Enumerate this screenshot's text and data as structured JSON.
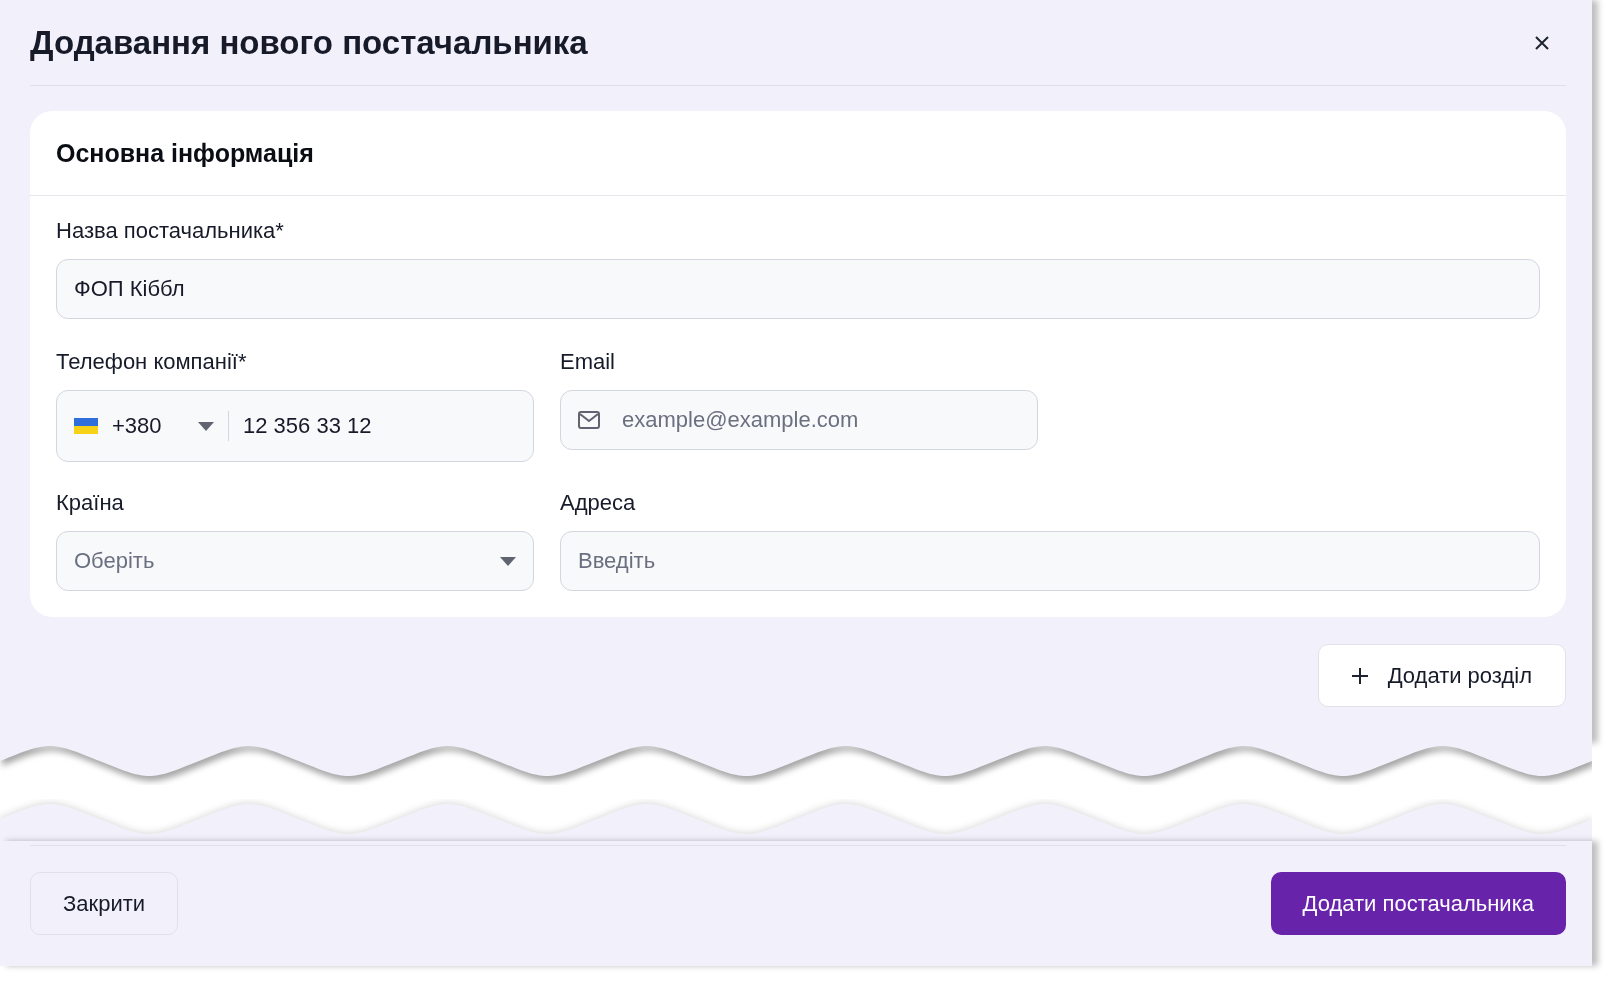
{
  "dialog": {
    "title": "Додавання нового постачальника"
  },
  "section": {
    "title": "Основна інформація"
  },
  "name_field": {
    "label": "Назва постачальника*",
    "value": "ФОП Кіббл"
  },
  "phone_field": {
    "label": "Телефон компанії*",
    "country_code": "+380",
    "value": "12 356 33 12"
  },
  "email_field": {
    "label": "Email",
    "placeholder": "example@example.com"
  },
  "country_field": {
    "label": "Країна",
    "placeholder": "Оберіть"
  },
  "address_field": {
    "label": "Адреса",
    "placeholder": "Введіть"
  },
  "add_section_button": {
    "label": "Додати розділ"
  },
  "footer": {
    "close_button": "Закрити",
    "submit_button": "Додати постачальника"
  }
}
